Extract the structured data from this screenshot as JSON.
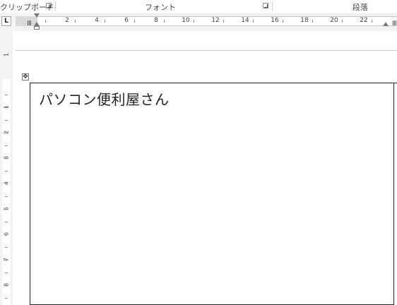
{
  "ribbon": {
    "groups": [
      {
        "label": "クリップボード"
      },
      {
        "label": "フォント"
      },
      {
        "label": "段落"
      }
    ]
  },
  "ruler": {
    "tab_selector": "L",
    "horizontal_labels": [
      "2",
      "4",
      "6",
      "8",
      "10",
      "12",
      "14",
      "16",
      "18",
      "20",
      "22"
    ],
    "vertical_labels": [
      "1",
      "1",
      "2",
      "3",
      "4",
      "5",
      "6",
      "7",
      "8"
    ]
  },
  "table": {
    "move_handle_icon": "move-cross-icon",
    "cell_text": "パソコン便利屋さん"
  }
}
